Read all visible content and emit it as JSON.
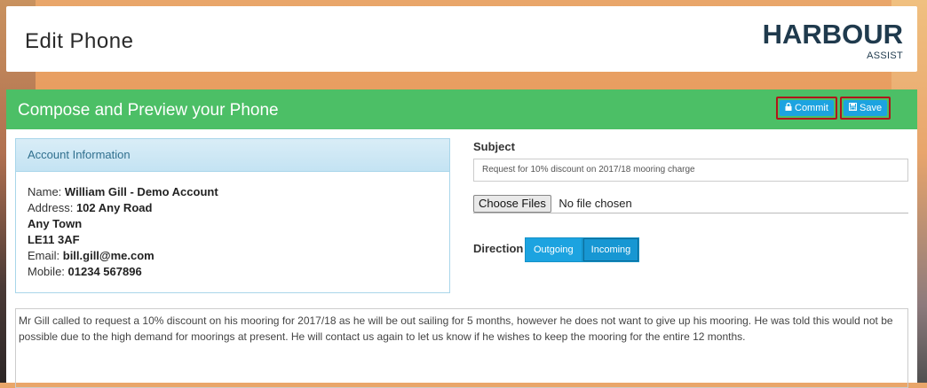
{
  "header": {
    "title": "Edit Phone",
    "logo": {
      "main": "HARBOUR",
      "sub": "ASSIST"
    }
  },
  "panel": {
    "title": "Compose and Preview your Phone",
    "commit_label": "Commit",
    "save_label": "Save"
  },
  "account": {
    "heading": "Account Information",
    "name_label": "Name:",
    "name": "William Gill - Demo Account",
    "address_label": "Address:",
    "address_lines": [
      "102 Any Road",
      "Any Town",
      "LE11 3AF"
    ],
    "email_label": "Email:",
    "email": "bill.gill@me.com",
    "mobile_label": "Mobile:",
    "mobile": "01234 567896"
  },
  "form": {
    "subject_label": "Subject",
    "subject_value": "Request for 10% discount on 2017/18 mooring charge",
    "file_button": "Choose Files",
    "file_status": "No file chosen",
    "direction_label": "Direction",
    "direction_options": [
      "Outgoing",
      "Incoming"
    ],
    "direction_selected": "Incoming",
    "notes": "Mr Gill called to request a 10% discount on his mooring for 2017/18 as he will be out sailing for 5 months, however he does not want to give up his mooring.  He was told this would not be possible due to the high demand for moorings at present.  He will contact us again to let us know if he wishes to keep the mooring for the entire 12 months."
  },
  "colors": {
    "panel_header": "#4cbf66",
    "button": "#1ca3e0",
    "highlight_outline": "#b0151a",
    "logo": "#1f3a4d"
  }
}
